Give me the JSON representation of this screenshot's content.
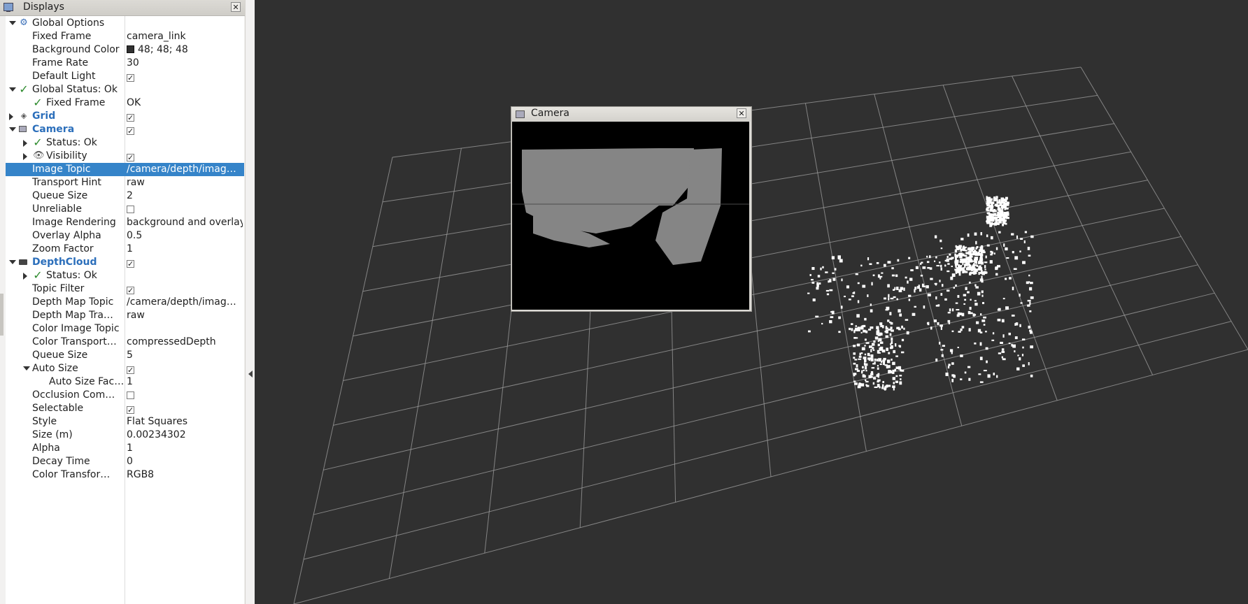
{
  "displays": {
    "title": "Displays",
    "close": "✕",
    "rows": [
      {
        "label": "Global Options",
        "value": "",
        "arrow": "down",
        "icon": "gear",
        "indent": 0,
        "bold": false
      },
      {
        "label": "Fixed Frame",
        "value": "camera_link",
        "arrow": "",
        "icon": "",
        "indent": 1
      },
      {
        "label": "Background Color",
        "value": "48; 48; 48",
        "arrow": "",
        "icon": "",
        "indent": 1,
        "swatch": "#303030"
      },
      {
        "label": "Frame Rate",
        "value": "30",
        "arrow": "",
        "icon": "",
        "indent": 1
      },
      {
        "label": "Default Light",
        "value": "",
        "arrow": "",
        "icon": "",
        "indent": 1,
        "checkbox": true
      },
      {
        "label": "Global Status: Ok",
        "value": "",
        "arrow": "down",
        "icon": "check",
        "indent": 0
      },
      {
        "label": "Fixed Frame",
        "value": "OK",
        "arrow": "",
        "icon": "check",
        "indent": 1
      },
      {
        "label": "Grid",
        "value": "",
        "arrow": "right",
        "icon": "grid",
        "indent": 0,
        "bold": true,
        "checkbox": true
      },
      {
        "label": "Camera",
        "value": "",
        "arrow": "down",
        "icon": "cam",
        "indent": 0,
        "bold": true,
        "checkbox": true
      },
      {
        "label": "Status: Ok",
        "value": "",
        "arrow": "right",
        "icon": "check",
        "indent": 1
      },
      {
        "label": "Visibility",
        "value": "",
        "arrow": "right",
        "icon": "eye",
        "indent": 1,
        "checkbox": true
      },
      {
        "label": "Image Topic",
        "value": "/camera/depth/imag…",
        "arrow": "",
        "icon": "",
        "indent": 1,
        "selected": true
      },
      {
        "label": "Transport Hint",
        "value": "raw",
        "arrow": "",
        "icon": "",
        "indent": 1
      },
      {
        "label": "Queue Size",
        "value": "2",
        "arrow": "",
        "icon": "",
        "indent": 1
      },
      {
        "label": "Unreliable",
        "value": "",
        "arrow": "",
        "icon": "",
        "indent": 1,
        "checkbox": false
      },
      {
        "label": "Image Rendering",
        "value": "background and overlay",
        "arrow": "",
        "icon": "",
        "indent": 1
      },
      {
        "label": "Overlay Alpha",
        "value": "0.5",
        "arrow": "",
        "icon": "",
        "indent": 1
      },
      {
        "label": "Zoom Factor",
        "value": "1",
        "arrow": "",
        "icon": "",
        "indent": 1
      },
      {
        "label": "DepthCloud",
        "value": "",
        "arrow": "down",
        "icon": "dc",
        "indent": 0,
        "bold": true,
        "checkbox": true
      },
      {
        "label": "Status: Ok",
        "value": "",
        "arrow": "right",
        "icon": "check",
        "indent": 1
      },
      {
        "label": "Topic Filter",
        "value": "",
        "arrow": "",
        "icon": "",
        "indent": 1,
        "checkbox": true
      },
      {
        "label": "Depth Map Topic",
        "value": "/camera/depth/imag…",
        "arrow": "",
        "icon": "",
        "indent": 1
      },
      {
        "label": "Depth Map Tra…",
        "value": "raw",
        "arrow": "",
        "icon": "",
        "indent": 1
      },
      {
        "label": "Color Image Topic",
        "value": "",
        "arrow": "",
        "icon": "",
        "indent": 1
      },
      {
        "label": "Color Transport…",
        "value": "compressedDepth",
        "arrow": "",
        "icon": "",
        "indent": 1
      },
      {
        "label": "Queue Size",
        "value": "5",
        "arrow": "",
        "icon": "",
        "indent": 1
      },
      {
        "label": "Auto Size",
        "value": "",
        "arrow": "down",
        "icon": "",
        "indent": 1,
        "checkbox": true
      },
      {
        "label": "Auto Size Fac…",
        "value": "1",
        "arrow": "",
        "icon": "",
        "indent": 2
      },
      {
        "label": "Occlusion Com…",
        "value": "",
        "arrow": "",
        "icon": "",
        "indent": 1,
        "checkbox": false
      },
      {
        "label": "Selectable",
        "value": "",
        "arrow": "",
        "icon": "",
        "indent": 1,
        "checkbox": true
      },
      {
        "label": "Style",
        "value": "Flat Squares",
        "arrow": "",
        "icon": "",
        "indent": 1
      },
      {
        "label": "Size (m)",
        "value": "0.00234302",
        "arrow": "",
        "icon": "",
        "indent": 1
      },
      {
        "label": "Alpha",
        "value": "1",
        "arrow": "",
        "icon": "",
        "indent": 1
      },
      {
        "label": "Decay Time",
        "value": "0",
        "arrow": "",
        "icon": "",
        "indent": 1
      },
      {
        "label": "Color Transfor…",
        "value": "RGB8",
        "arrow": "",
        "icon": "",
        "indent": 1
      }
    ]
  },
  "camera_window": {
    "title": "Camera",
    "close": "✕"
  },
  "colors": {
    "background": "#303030",
    "grid": "#a0a0a0",
    "selection": "#3584c9",
    "display_name": "#2c6fbb",
    "status_ok": "#2e8b2e"
  }
}
